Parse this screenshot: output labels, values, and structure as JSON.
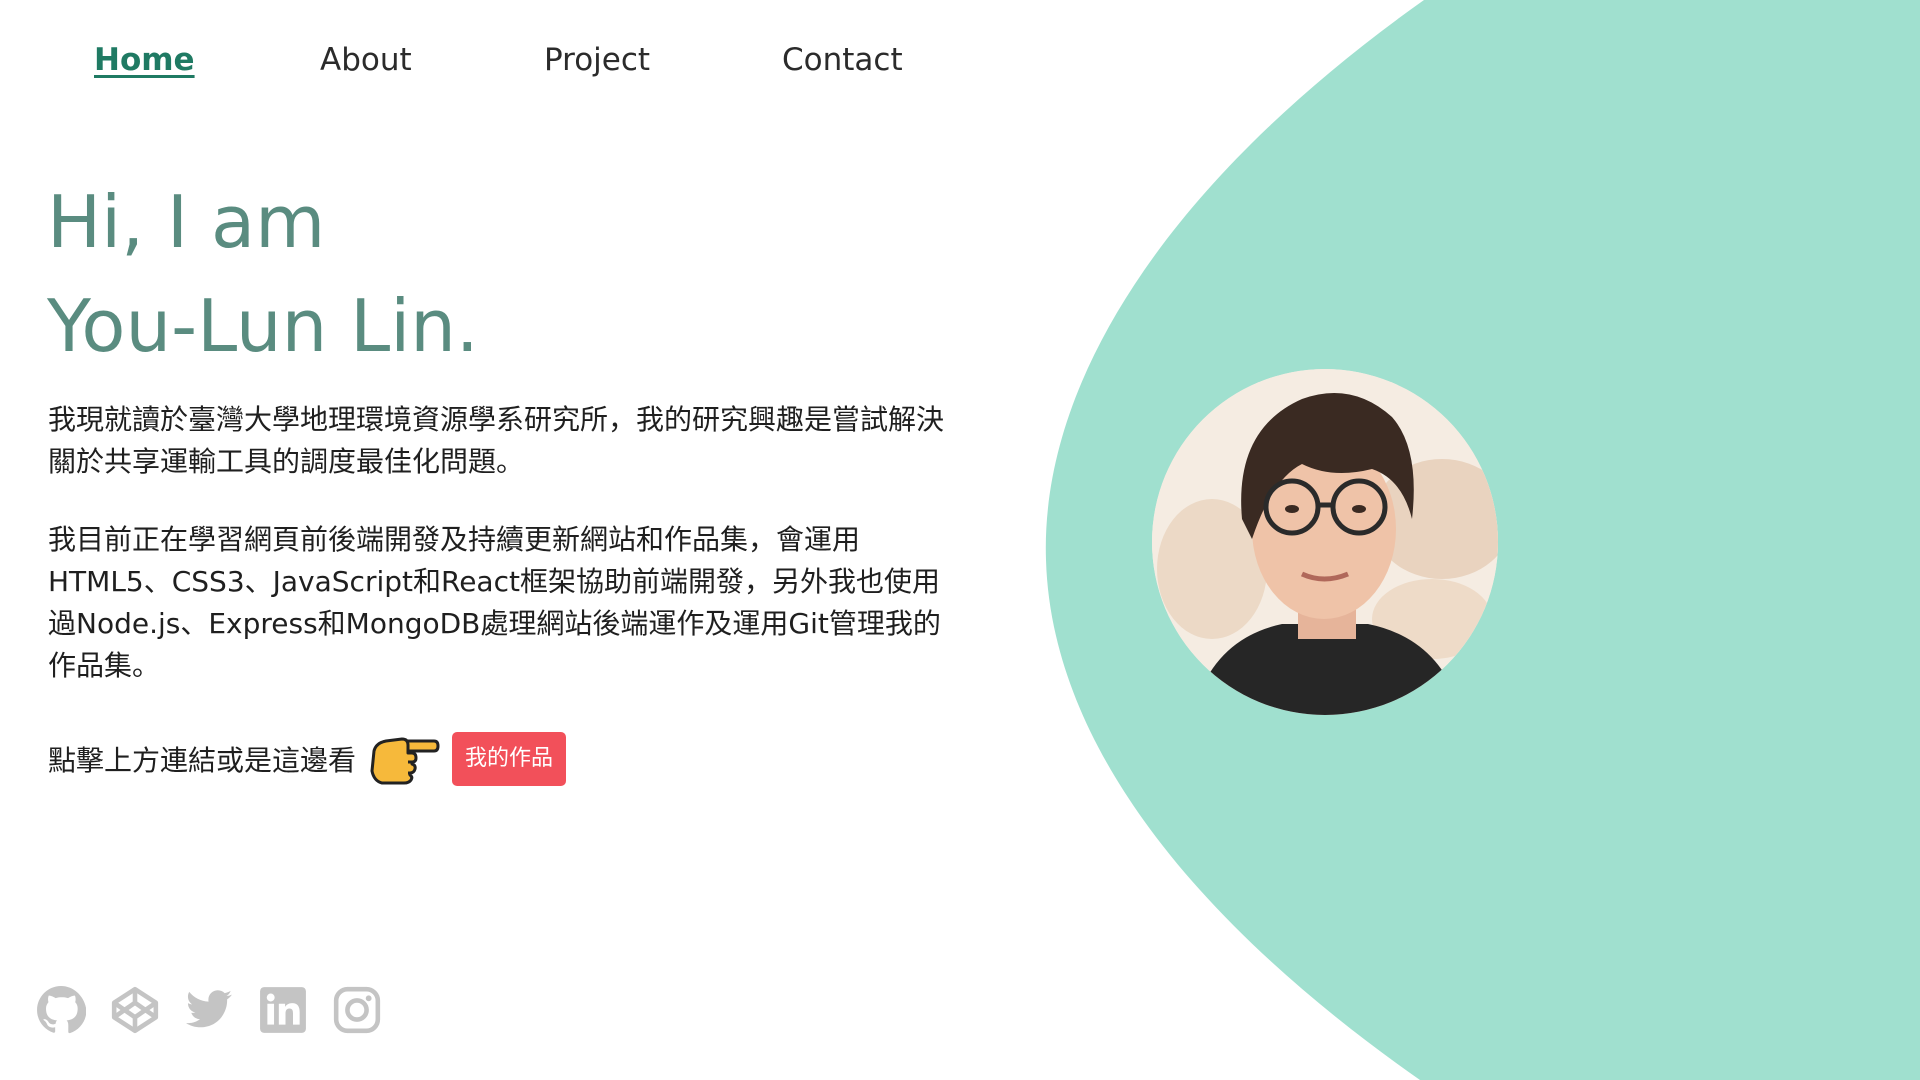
{
  "nav": {
    "items": [
      {
        "label": "Home",
        "active": true
      },
      {
        "label": "About",
        "active": false
      },
      {
        "label": "Project",
        "active": false
      },
      {
        "label": "Contact",
        "active": false
      }
    ]
  },
  "hero": {
    "line1": "Hi, I am",
    "line2": "You-Lun Lin."
  },
  "intro": {
    "paragraph1": "我現就讀於臺灣大學地理環境資源學系研究所，我的研究興趣是嘗試解決關於共享運輸工具的調度最佳化問題。",
    "paragraph2": "我目前正在學習網頁前後端開發及持續更新網站和作品集，會運用HTML5、CSS3、JavaScript和React框架協助前端開發，另外我也使用過Node.js、Express和MongoDB處理網站後端運作及運用Git管理我的作品集。"
  },
  "cta": {
    "text": "點擊上方連結或是這邊看",
    "hand_icon": "pointing-right-hand-icon",
    "button_label": "我的作品"
  },
  "avatar": {
    "icon": "profile-photo"
  },
  "social": {
    "icons": [
      "github-icon",
      "codepen-icon",
      "twitter-icon",
      "linkedin-icon",
      "instagram-icon"
    ],
    "color": "#c4c4c4"
  },
  "colors": {
    "accent_nav": "#1f7a63",
    "hero_text": "#5a8c80",
    "blob": "#a0e0cf",
    "button": "#f2505a"
  }
}
